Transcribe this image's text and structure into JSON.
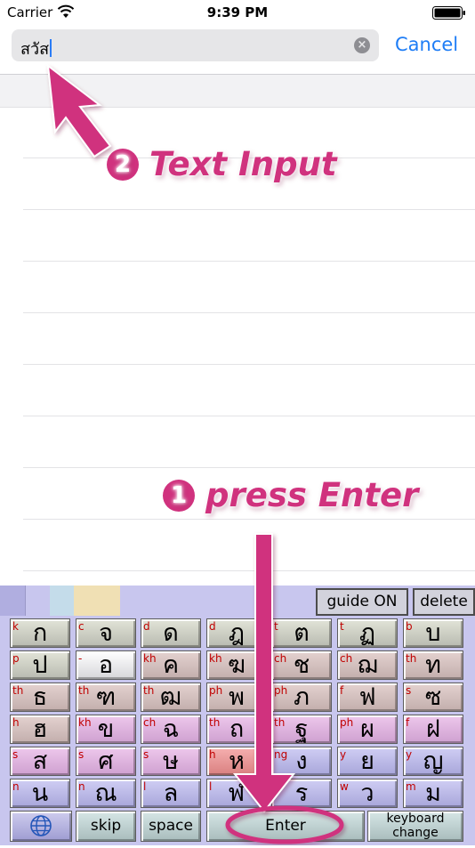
{
  "status_bar": {
    "carrier": "Carrier",
    "time": "9:39 PM"
  },
  "search": {
    "value": "สวัส",
    "cancel_label": "Cancel"
  },
  "annotations": {
    "text_input": {
      "number": "2",
      "label": "Text Input"
    },
    "press_enter": {
      "number": "1",
      "label": "press Enter"
    }
  },
  "keyboard": {
    "guide_label": "guide ON",
    "delete_label": "delete",
    "rows": [
      [
        {
          "r": "k",
          "t": "ก",
          "c": "grey"
        },
        {
          "r": "c",
          "t": "จ",
          "c": "grey"
        },
        {
          "r": "d",
          "t": "ด",
          "c": "grey"
        },
        {
          "r": "d",
          "t": "ฎ",
          "c": "grey"
        },
        {
          "r": "t",
          "t": "ต",
          "c": "grey"
        },
        {
          "r": "t",
          "t": "ฏ",
          "c": "grey"
        },
        {
          "r": "b",
          "t": "บ",
          "c": "grey"
        }
      ],
      [
        {
          "r": "p",
          "t": "ป",
          "c": "grey"
        },
        {
          "r": "-",
          "t": "อ",
          "c": "white"
        },
        {
          "r": "kh",
          "t": "ค",
          "c": "tan"
        },
        {
          "r": "kh",
          "t": "ฆ",
          "c": "tan"
        },
        {
          "r": "ch",
          "t": "ช",
          "c": "tan"
        },
        {
          "r": "ch",
          "t": "ฌ",
          "c": "tan"
        },
        {
          "r": "th",
          "t": "ท",
          "c": "tan"
        }
      ],
      [
        {
          "r": "th",
          "t": "ธ",
          "c": "tan"
        },
        {
          "r": "th",
          "t": "ฑ",
          "c": "tan"
        },
        {
          "r": "th",
          "t": "ฒ",
          "c": "tan"
        },
        {
          "r": "ph",
          "t": "พ",
          "c": "tan"
        },
        {
          "r": "ph",
          "t": "ภ",
          "c": "tan"
        },
        {
          "r": "f",
          "t": "ฟ",
          "c": "tan"
        },
        {
          "r": "s",
          "t": "ซ",
          "c": "tan"
        }
      ],
      [
        {
          "r": "h",
          "t": "ฮ",
          "c": "tan"
        },
        {
          "r": "kh",
          "t": "ข",
          "c": "pink"
        },
        {
          "r": "ch",
          "t": "ฉ",
          "c": "pink"
        },
        {
          "r": "th",
          "t": "ถ",
          "c": "pink"
        },
        {
          "r": "th",
          "t": "ฐ",
          "c": "pink"
        },
        {
          "r": "ph",
          "t": "ผ",
          "c": "pink"
        },
        {
          "r": "f",
          "t": "ฝ",
          "c": "pink"
        }
      ],
      [
        {
          "r": "s",
          "t": "ส",
          "c": "pink"
        },
        {
          "r": "s",
          "t": "ศ",
          "c": "pink"
        },
        {
          "r": "s",
          "t": "ษ",
          "c": "pink"
        },
        {
          "r": "h",
          "t": "ห",
          "c": "red"
        },
        {
          "r": "ng",
          "t": "ง",
          "c": "lav"
        },
        {
          "r": "y",
          "t": "ย",
          "c": "lav"
        },
        {
          "r": "y",
          "t": "ญ",
          "c": "lav"
        }
      ],
      [
        {
          "r": "n",
          "t": "น",
          "c": "lav"
        },
        {
          "r": "n",
          "t": "ณ",
          "c": "lav"
        },
        {
          "r": "l",
          "t": "ล",
          "c": "lav"
        },
        {
          "r": "l",
          "t": "ฬ",
          "c": "lav"
        },
        {
          "r": "r",
          "t": "ร",
          "c": "lav"
        },
        {
          "r": "w",
          "t": "ว",
          "c": "lav"
        },
        {
          "r": "m",
          "t": "ม",
          "c": "lav"
        }
      ]
    ],
    "bottom": {
      "skip": "skip",
      "space": "space",
      "enter": "Enter",
      "keyboard_change_1": "keyboard",
      "keyboard_change_2": "change"
    }
  },
  "colors": {
    "annotation": "#d0327e",
    "ios_blue": "#1e7df6",
    "keyboard_bg": "#c8c6ee"
  }
}
